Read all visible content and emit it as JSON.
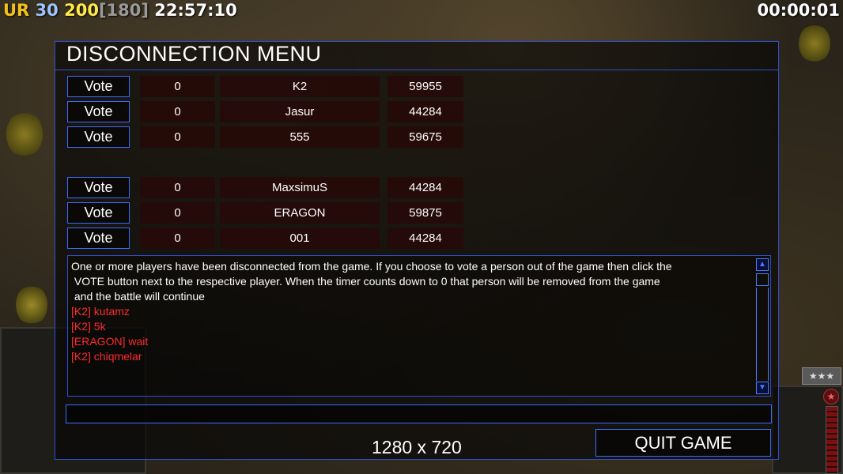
{
  "hud": {
    "faction": "UR",
    "power": "30",
    "units": "200",
    "unit_cap": "[180]",
    "clock": "22:57:10",
    "game_timer": "00:00:01"
  },
  "dialog": {
    "title": "DISCONNECTION MENU",
    "vote_label": "Vote",
    "players": [
      {
        "votes": "0",
        "name": "K2",
        "ping": "59955"
      },
      {
        "votes": "0",
        "name": "Jasur",
        "ping": "44284"
      },
      {
        "votes": "0",
        "name": "555",
        "ping": "59675"
      },
      {
        "votes": "0",
        "name": "MaxsimuS",
        "ping": "44284"
      },
      {
        "votes": "0",
        "name": "ERAGON",
        "ping": "59875"
      },
      {
        "votes": "0",
        "name": "001",
        "ping": "44284"
      }
    ],
    "message": "One or more players have been disconnected from the game. If you choose to vote a person out of the game then click the",
    "message_line2": " VOTE button next to the respective player. When the timer counts down to 0 that person will be removed from the game",
    "message_line3": " and the battle will continue",
    "chat": [
      "[K2] kutamz",
      "[K2] 5k",
      "[ERAGON] wait",
      "[K2] chiqmelar"
    ],
    "chat_input_value": "",
    "resolution": "1280 x 720",
    "quit_label": "QUIT GAME"
  },
  "rank_badge": "★★★",
  "colors": {
    "border_blue": "#2f4fd0",
    "chat_red": "#ff2a2a",
    "faction_yellow": "#f2c21a"
  }
}
